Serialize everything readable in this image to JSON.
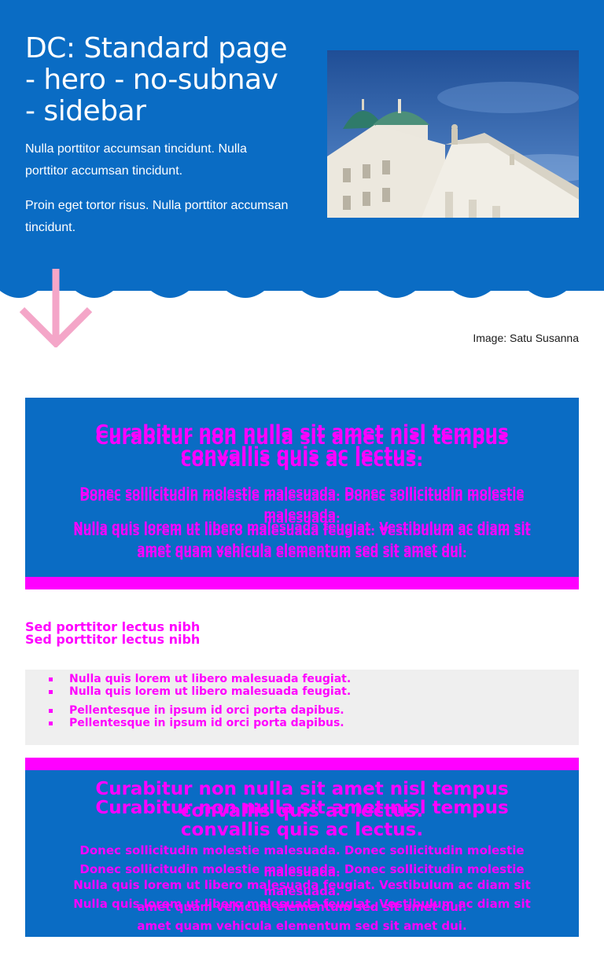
{
  "hero": {
    "title": "DC: Standard page - hero - no-subnav - sidebar",
    "paragraph1": "Nulla porttitor accumsan tincidunt. Nulla porttitor accumsan tincidunt.",
    "paragraph2": "Proin eget tortor risus. Nulla porttitor accumsan tincidunt.",
    "image_caption": "Image: Satu Susanna",
    "background_color": "#0a6cc4"
  },
  "scroll_arrow": {
    "icon": "arrow-down-icon",
    "color": "#f4a6c8"
  },
  "banner": {
    "title": "Curabitur non nulla sit amet nisl tempus convallis quis ac lectus.",
    "text1": "Donec sollicitudin molestie malesuada. Donec sollicitudin molestie malesuada.",
    "text2": "Nulla quis lorem ut libero malesuada feugiat. Vestibulum ac diam sit amet quam vehicula elementum sed sit amet dui.",
    "accent_color": "#ff00ff"
  },
  "section": {
    "heading": "Sed porttitor lectus nibh",
    "list": [
      "Nulla quis lorem ut libero malesuada feugiat.",
      "Pellentesque in ipsum id orci porta dapibus."
    ]
  }
}
